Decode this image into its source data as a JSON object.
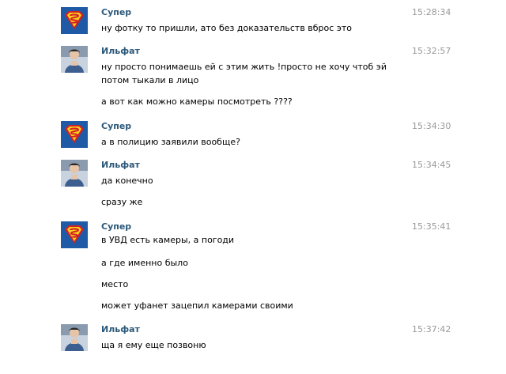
{
  "colors": {
    "author": "#2b587a",
    "time": "#999999",
    "text": "#000000"
  },
  "messages": [
    {
      "avatar": "superman-icon",
      "author": "Супер",
      "time": "15:28:34",
      "lines": [
        "ну фотку то пришли, ато без доказательств вброс это"
      ]
    },
    {
      "avatar": "user-photo",
      "author": "Ильфат",
      "time": "15:32:57",
      "lines": [
        "ну просто понимаешь ей с этим жить !просто не хочу чтоб эй",
        "потом тыкали в лицо",
        "а вот как можно камеры посмотреть ????"
      ]
    },
    {
      "avatar": "superman-icon",
      "author": "Супер",
      "time": "15:34:30",
      "lines": [
        "а в полицию заявили вообще?"
      ]
    },
    {
      "avatar": "user-photo",
      "author": "Ильфат",
      "time": "15:34:45",
      "lines": [
        "да конечно",
        "сразу же"
      ]
    },
    {
      "avatar": "superman-icon",
      "author": "Супер",
      "time": "15:35:41",
      "lines": [
        "в УВД есть камеры, а погоди",
        "а где именно было",
        "место",
        "может уфанет зацепил камерами своими"
      ]
    },
    {
      "avatar": "user-photo",
      "author": "Ильфат",
      "time": "15:37:42",
      "lines": [
        "ща я ему еще позвоню"
      ]
    }
  ]
}
